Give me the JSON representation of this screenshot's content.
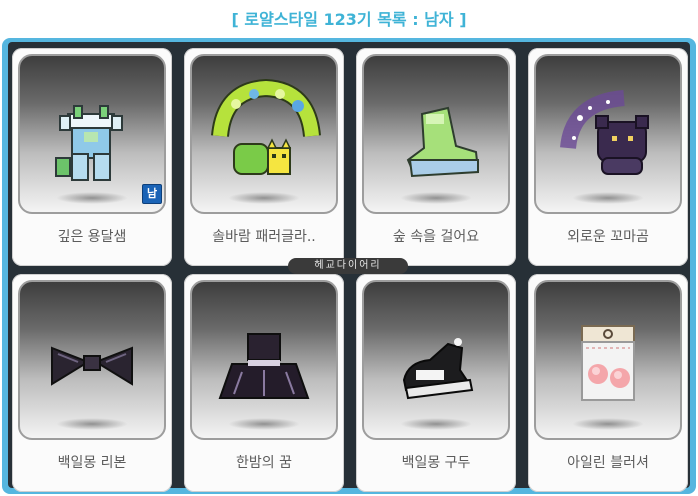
{
  "header": {
    "title": "[ 로얄스타일 123기 목록 : 남자 ]"
  },
  "items": [
    {
      "name": "깊은 용달샘",
      "icon": "overalls-outfit-icon",
      "badge": "남"
    },
    {
      "name": "솔바람 패러글라..",
      "icon": "leaf-wreath-cat-icon"
    },
    {
      "name": "숲 속을 걸어요",
      "icon": "green-shoes-icon"
    },
    {
      "name": "외로운 꼬마곰",
      "icon": "purple-bear-icon"
    },
    {
      "name": "백일몽 리본",
      "icon": "black-ribbon-icon"
    },
    {
      "name": "한밤의 꿈",
      "icon": "dark-dress-icon"
    },
    {
      "name": "백일몽 구두",
      "icon": "black-shoes-icon"
    },
    {
      "name": "아일린 블러셔",
      "icon": "blusher-packet-icon"
    }
  ],
  "watermark": "헤교다이어리",
  "colors": {
    "title": "#3fb3d6",
    "panel": "#55b6df",
    "panel_inner": "#273037",
    "badge": "#1a63b6"
  }
}
